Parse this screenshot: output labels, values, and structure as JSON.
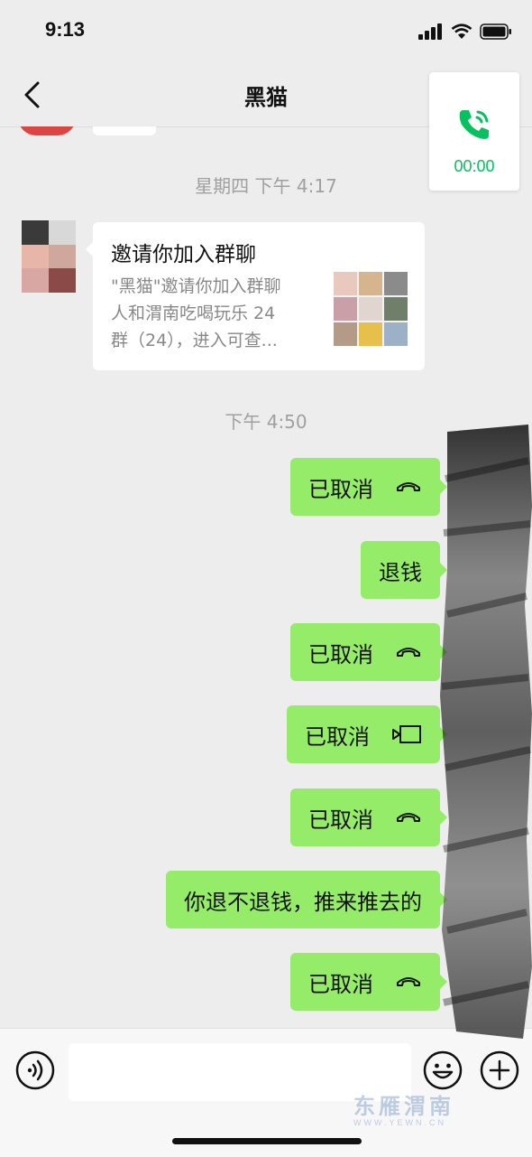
{
  "status_bar": {
    "time": "9:13"
  },
  "nav": {
    "title": "黑猫"
  },
  "call_card": {
    "timer": "00:00"
  },
  "timestamps": [
    "星期四 下午 4:17",
    "下午 4:50"
  ],
  "card": {
    "title": "邀请你加入群聊",
    "description": "\"黑猫\"邀请你加入群聊\n人和渭南吃喝玩乐 24\n群（24），进入可查..."
  },
  "messages": [
    {
      "text": "已取消",
      "icon": "voice-call-icon"
    },
    {
      "text": "退钱",
      "icon": ""
    },
    {
      "text": "已取消",
      "icon": "voice-call-icon"
    },
    {
      "text": "已取消",
      "icon": "video-call-icon"
    },
    {
      "text": "已取消",
      "icon": "voice-call-icon"
    },
    {
      "text": "你退不退钱，推来推去的",
      "icon": ""
    },
    {
      "text": "已取消",
      "icon": "voice-call-icon"
    }
  ],
  "watermark": {
    "main": "东雁渭南",
    "sub": "WWW.YEWN.CN"
  },
  "colors": {
    "bubble_green": "#95ec69",
    "wechat_green": "#07c160",
    "background": "#ededed"
  }
}
